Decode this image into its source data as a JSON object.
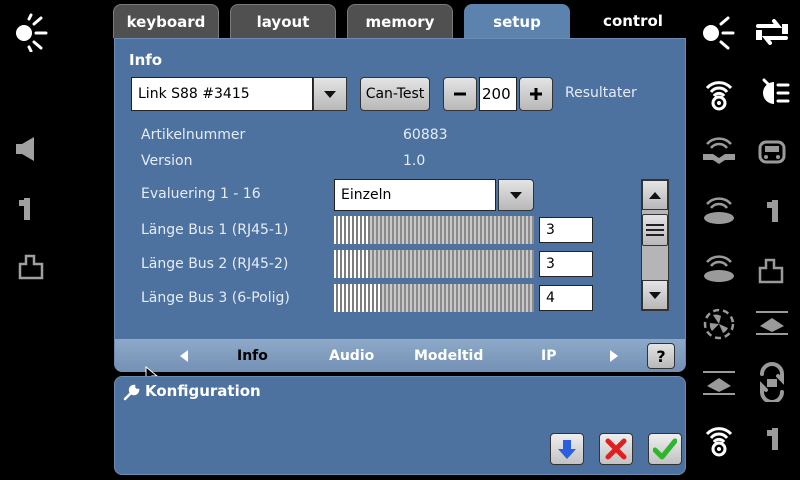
{
  "tabs": {
    "keyboard": "keyboard",
    "layout": "layout",
    "memory": "memory",
    "setup": "setup",
    "control": "control"
  },
  "info": {
    "header": "Info",
    "device_selected": "Link S88 #3415",
    "can_test_label": "Can-Test",
    "result_value": "200",
    "result_label": "Resultater",
    "article_label": "Artikelnummer",
    "article_value": "60883",
    "version_label": "Version",
    "version_value": "1.0",
    "evaluation_label": "Evaluering 1 - 16",
    "evaluation_value": "Einzeln",
    "bus_rows": [
      {
        "label": "Länge Bus 1 (RJ45-1)",
        "value": "3",
        "level": 0.03
      },
      {
        "label": "Länge Bus 2 (RJ45-2)",
        "value": "3",
        "level": 0.03
      },
      {
        "label": "Länge Bus 3 (6-Polig)",
        "value": "4",
        "level": 0.04
      }
    ]
  },
  "sub_tabs": {
    "info": "Info",
    "audio": "Audio",
    "modeltid": "Modeltid",
    "ip": "IP",
    "help": "?"
  },
  "config": {
    "header": "Konfiguration"
  },
  "icons": {
    "left": [
      "light-icon",
      "horn-icon",
      "coupler-icon",
      "uncoupler-icon"
    ],
    "right": [
      "light-icon",
      "swap-icon",
      "radio-signal-icon",
      "high-beam-icon",
      "signal-horn-icon",
      "cab-light-icon",
      "radio-speech-icon",
      "coupler-icon",
      "radio-speech-icon",
      "uncoupler-icon",
      "fan-icon",
      "pantograph-icon",
      "pantograph-icon",
      "shunting-icon",
      "radio-signal-icon",
      "coupler-icon"
    ]
  },
  "colors": {
    "panel": "#4e72a0",
    "accent_active_tab": "#5c82ae",
    "confirm_green": "#2db52d",
    "cancel_red": "#e02020",
    "down_blue": "#2a5fe0"
  }
}
